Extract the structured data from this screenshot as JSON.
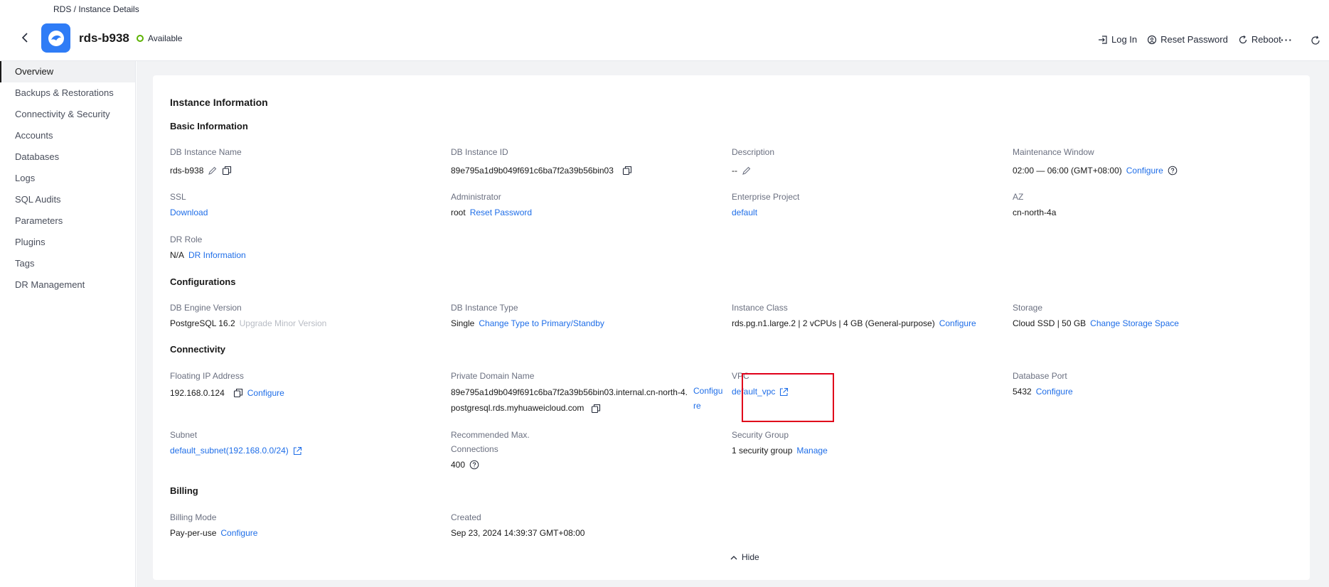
{
  "breadcrumb": "RDS / Instance Details",
  "instance": {
    "name": "rds-b938",
    "status": "Available"
  },
  "actions": {
    "login": "Log In",
    "reset_password": "Reset Password",
    "reboot": "Reboot",
    "more": "···"
  },
  "sidebar": {
    "items": [
      {
        "label": "Overview"
      },
      {
        "label": "Backups & Restorations"
      },
      {
        "label": "Connectivity & Security"
      },
      {
        "label": "Accounts"
      },
      {
        "label": "Databases"
      },
      {
        "label": "Logs"
      },
      {
        "label": "SQL Audits"
      },
      {
        "label": "Parameters"
      },
      {
        "label": "Plugins"
      },
      {
        "label": "Tags"
      },
      {
        "label": "DR Management"
      }
    ]
  },
  "card": {
    "title": "Instance Information",
    "hide": "Hide"
  },
  "basic": {
    "title": "Basic Information",
    "db_instance_name": {
      "label": "DB Instance Name",
      "value": "rds-b938"
    },
    "db_instance_id": {
      "label": "DB Instance ID",
      "value": "89e795a1d9b049f691c6ba7f2a39b56bin03"
    },
    "description": {
      "label": "Description",
      "value": "--"
    },
    "maintenance": {
      "label": "Maintenance Window",
      "value": "02:00 — 06:00 (GMT+08:00)",
      "link": "Configure"
    },
    "ssl": {
      "label": "SSL",
      "link": "Download"
    },
    "administrator": {
      "label": "Administrator",
      "value": "root",
      "link": "Reset Password"
    },
    "enterprise_project": {
      "label": "Enterprise Project",
      "link": "default"
    },
    "az": {
      "label": "AZ",
      "value": "cn-north-4a"
    },
    "dr_role": {
      "label": "DR Role",
      "value": "N/A",
      "link": "DR Information"
    }
  },
  "configurations": {
    "title": "Configurations",
    "engine": {
      "label": "DB Engine Version",
      "value": "PostgreSQL 16.2",
      "disabled_link": "Upgrade Minor Version"
    },
    "type": {
      "label": "DB Instance Type",
      "value": "Single",
      "link": "Change Type to Primary/Standby"
    },
    "class": {
      "label": "Instance Class",
      "value": "rds.pg.n1.large.2 | 2 vCPUs | 4 GB (General-purpose)",
      "link": "Configure"
    },
    "storage": {
      "label": "Storage",
      "value": "Cloud SSD | 50 GB",
      "link": "Change Storage Space"
    }
  },
  "connectivity": {
    "title": "Connectivity",
    "floating_ip": {
      "label": "Floating IP Address",
      "value": "192.168.0.124",
      "link": "Configure"
    },
    "domain": {
      "label": "Private Domain Name",
      "value": "89e795a1d9b049f691c6ba7f2a39b56bin03.internal.cn-north-4.postgresql.rds.myhuaweicloud.com",
      "link": "Configure"
    },
    "vpc": {
      "label": "VPC",
      "link": "default_vpc"
    },
    "port": {
      "label": "Database Port",
      "value": "5432",
      "link": "Configure"
    },
    "subnet": {
      "label": "Subnet",
      "link": "default_subnet(192.168.0.0/24)"
    },
    "max_conn": {
      "label": "Recommended Max. Connections",
      "value": "400"
    },
    "security_group": {
      "label": "Security Group",
      "value": "1 security group",
      "link": "Manage"
    }
  },
  "billing": {
    "title": "Billing",
    "mode": {
      "label": "Billing Mode",
      "value": "Pay-per-use",
      "link": "Configure"
    },
    "created": {
      "label": "Created",
      "value": "Sep 23, 2024 14:39:37 GMT+08:00"
    }
  },
  "colors": {
    "accent": "#1f6ee8",
    "status": "#5cb300",
    "highlight": "#e0001a",
    "logo": "#2f7cf6"
  }
}
